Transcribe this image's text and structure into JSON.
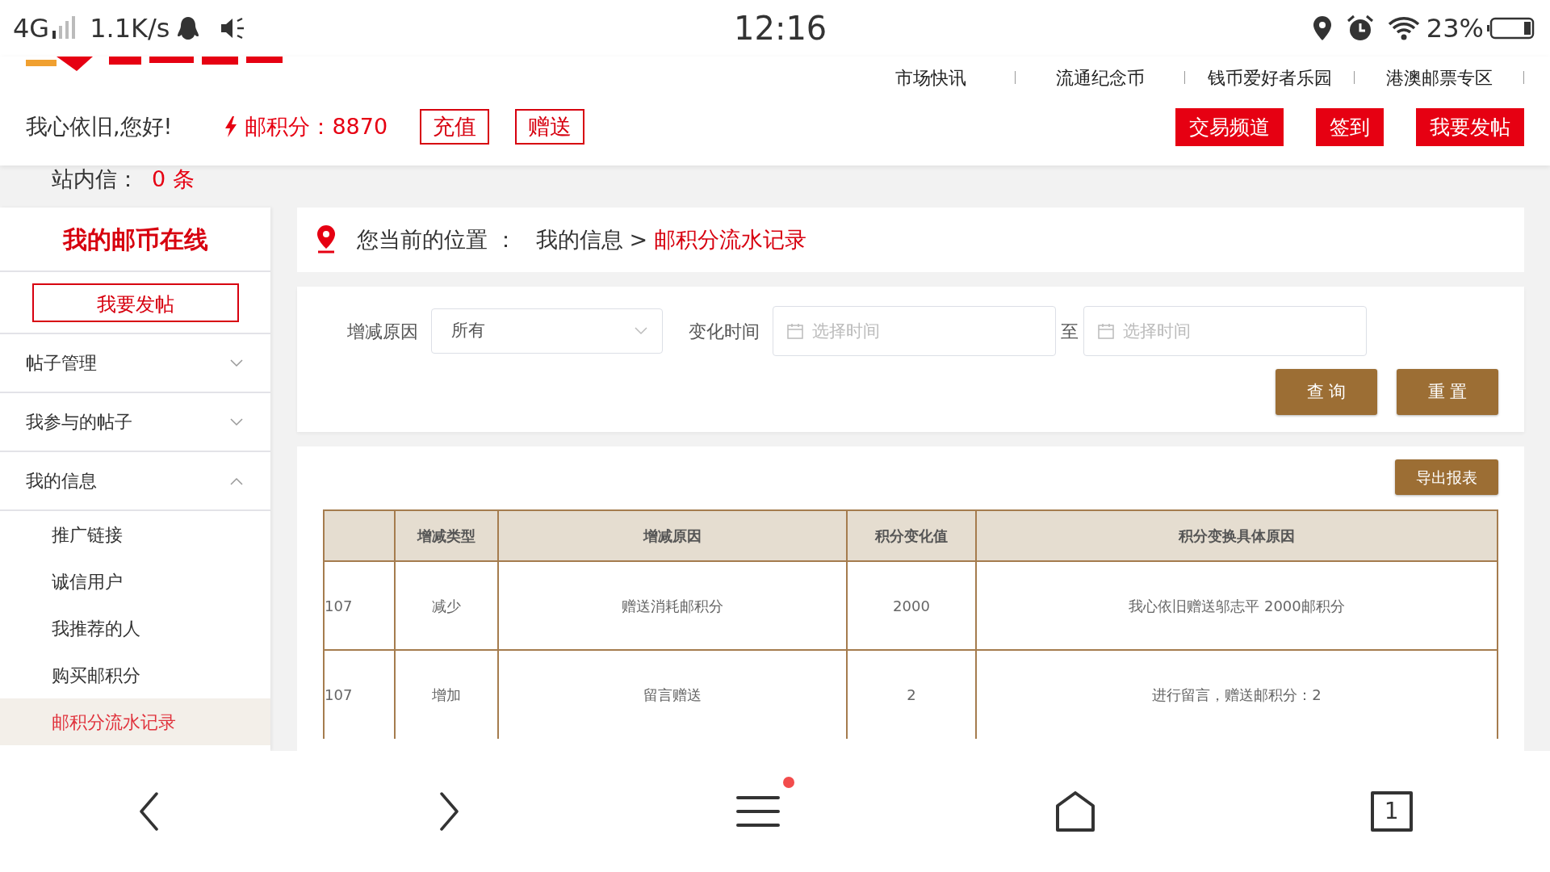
{
  "status_bar": {
    "network": "4G",
    "speed": "1.1K/s",
    "time": "12:16",
    "battery": "23%"
  },
  "top_links": [
    "市场快讯",
    "流通纪念币",
    "钱币爱好者乐园",
    "港澳邮票专区"
  ],
  "header": {
    "greeting": "我心依旧,您好!",
    "points": "邮积分：8870",
    "action_buttons": [
      "充值",
      "赠送"
    ],
    "main_buttons": [
      "交易频道",
      "签到",
      "我要发帖"
    ],
    "messages_label": "站内信：",
    "messages_count": "0 条"
  },
  "sidebar": {
    "title": "我的邮币在线",
    "post_button": "我要发帖",
    "items": [
      {
        "label": "帖子管理",
        "expanded": false
      },
      {
        "label": "我参与的帖子",
        "expanded": false
      },
      {
        "label": "我的信息",
        "expanded": true,
        "children": [
          {
            "label": "推广链接",
            "selected": false
          },
          {
            "label": "诚信用户",
            "selected": false
          },
          {
            "label": "我推荐的人",
            "selected": false
          },
          {
            "label": "购买邮积分",
            "selected": false
          },
          {
            "label": "邮积分流水记录",
            "selected": true
          }
        ]
      }
    ]
  },
  "breadcrumb": {
    "label": "您当前的位置 ：",
    "path": [
      {
        "label": "我的信息",
        "current": false
      },
      {
        "label": "邮积分流水记录",
        "current": true
      }
    ],
    "separator": ">"
  },
  "filter": {
    "reason_label": "增减原因",
    "reason_value": "所有",
    "time_label": "变化时间",
    "start_placeholder": "选择时间",
    "range_word": "至",
    "end_placeholder": "选择时间",
    "buttons": [
      "查 询",
      "重 置"
    ]
  },
  "table": {
    "export_button": "导出报表",
    "columns": [
      "增减类型",
      "增减原因",
      "积分变化值",
      "积分变换具体原因"
    ],
    "rows": [
      {
        "column_1": "107",
        "type": "减少",
        "reason": "赠送消耗邮积分",
        "change": "2000",
        "detail": "我心依旧赠送邬志平 2000邮积分"
      },
      {
        "column_1": "107",
        "type": "增加",
        "reason": "留言赠送",
        "change": "2",
        "detail": "进行留言，赠送邮积分：2"
      }
    ]
  },
  "bottom_nav": {
    "menu_badge": true,
    "tab_count": "1"
  }
}
